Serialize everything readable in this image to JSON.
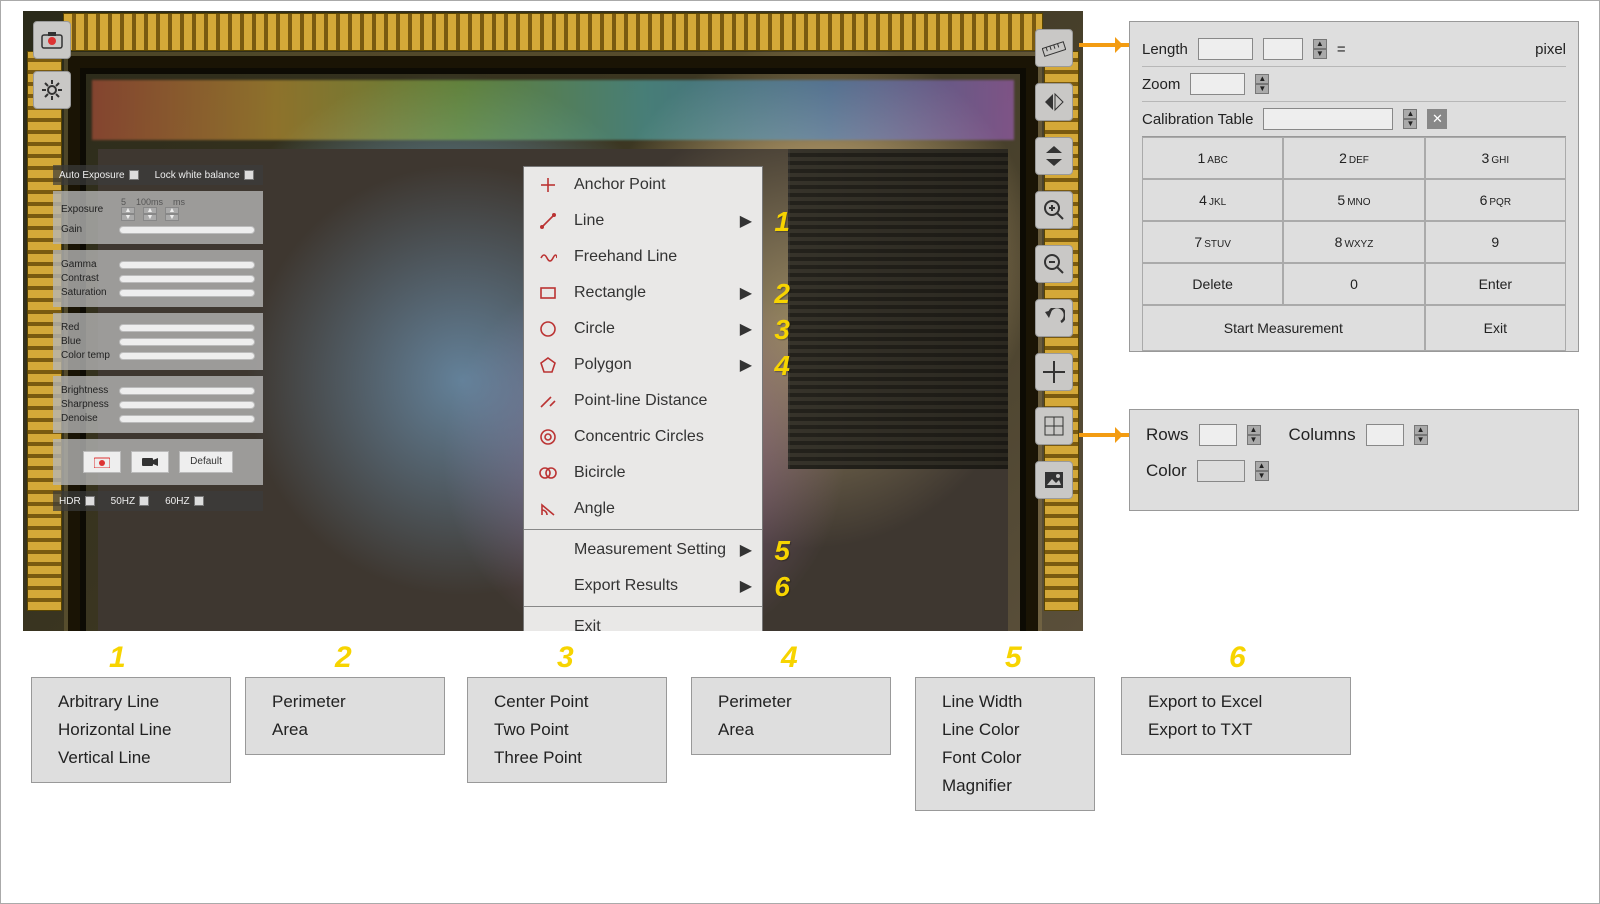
{
  "toolbar_icons": {
    "camera": "camera-icon",
    "gear": "gear-icon"
  },
  "side_tools": [
    "ruler-icon",
    "flip-h-icon",
    "flip-v-icon",
    "zoom-in-icon",
    "zoom-out-icon",
    "undo-icon",
    "crosshair-icon",
    "grid-icon",
    "image-icon"
  ],
  "image_panel": {
    "auto_exposure": "Auto Exposure",
    "lock_wb": "Lock white balance",
    "exposure_label": "Exposure",
    "exposure_vals": [
      "5",
      "100ms",
      "ms"
    ],
    "sliders_group1": [
      "Gain"
    ],
    "sliders_group2": [
      "Gamma",
      "Contrast",
      "Saturation"
    ],
    "sliders_group3": [
      "Red",
      "Blue",
      "Color temp"
    ],
    "sliders_group4": [
      "Brightness",
      "Sharpness",
      "Denoise"
    ],
    "default_btn": "Default",
    "flags": [
      "HDR",
      "50HZ",
      "60HZ"
    ]
  },
  "context_menu": {
    "items": [
      {
        "label": "Anchor Point",
        "icon": "plus",
        "sub": false
      },
      {
        "label": "Line",
        "icon": "line",
        "sub": true,
        "badge": "1"
      },
      {
        "label": "Freehand Line",
        "icon": "wave",
        "sub": false
      },
      {
        "label": "Rectangle",
        "icon": "rect",
        "sub": true,
        "badge": "2"
      },
      {
        "label": "Circle",
        "icon": "circle",
        "sub": true,
        "badge": "3"
      },
      {
        "label": "Polygon",
        "icon": "poly",
        "sub": true,
        "badge": "4"
      },
      {
        "label": "Point-line Distance",
        "icon": "dist",
        "sub": false
      },
      {
        "label": "Concentric Circles",
        "icon": "concentric",
        "sub": false
      },
      {
        "label": "Bicircle",
        "icon": "bicircle",
        "sub": false
      },
      {
        "label": "Angle",
        "icon": "angle",
        "sub": false
      }
    ],
    "section2": [
      {
        "label": "Measurement Setting",
        "sub": true,
        "badge": "5"
      },
      {
        "label": "Export Results",
        "sub": true,
        "badge": "6"
      }
    ],
    "exit": "Exit"
  },
  "calibration": {
    "length_label": "Length",
    "equals": "=",
    "unit": "pixel",
    "zoom_label": "Zoom",
    "table_label": "Calibration Table",
    "keys": [
      {
        "n": "1",
        "l": "ABC"
      },
      {
        "n": "2",
        "l": "DEF"
      },
      {
        "n": "3",
        "l": "GHI"
      },
      {
        "n": "4",
        "l": "JKL"
      },
      {
        "n": "5",
        "l": "MNO"
      },
      {
        "n": "6",
        "l": "PQR"
      },
      {
        "n": "7",
        "l": "STUV"
      },
      {
        "n": "8",
        "l": "WXYZ"
      },
      {
        "n": "9",
        "l": ""
      },
      {
        "n": "Delete",
        "l": ""
      },
      {
        "n": "0",
        "l": ""
      },
      {
        "n": "Enter",
        "l": ""
      }
    ],
    "start": "Start  Measurement",
    "exit": "Exit"
  },
  "grid_panel": {
    "rows_label": "Rows",
    "cols_label": "Columns",
    "color_label": "Color"
  },
  "submenus": {
    "1": [
      "Arbitrary Line",
      "Horizontal Line",
      "Vertical Line"
    ],
    "2": [
      "Perimeter",
      "Area"
    ],
    "3": [
      "Center Point",
      "Two Point",
      "Three Point"
    ],
    "4": [
      "Perimeter",
      "Area"
    ],
    "5": [
      "Line Width",
      "Line Color",
      "Font Color",
      "Magnifier"
    ],
    "6": [
      "Export to Excel",
      "Export to TXT"
    ]
  }
}
